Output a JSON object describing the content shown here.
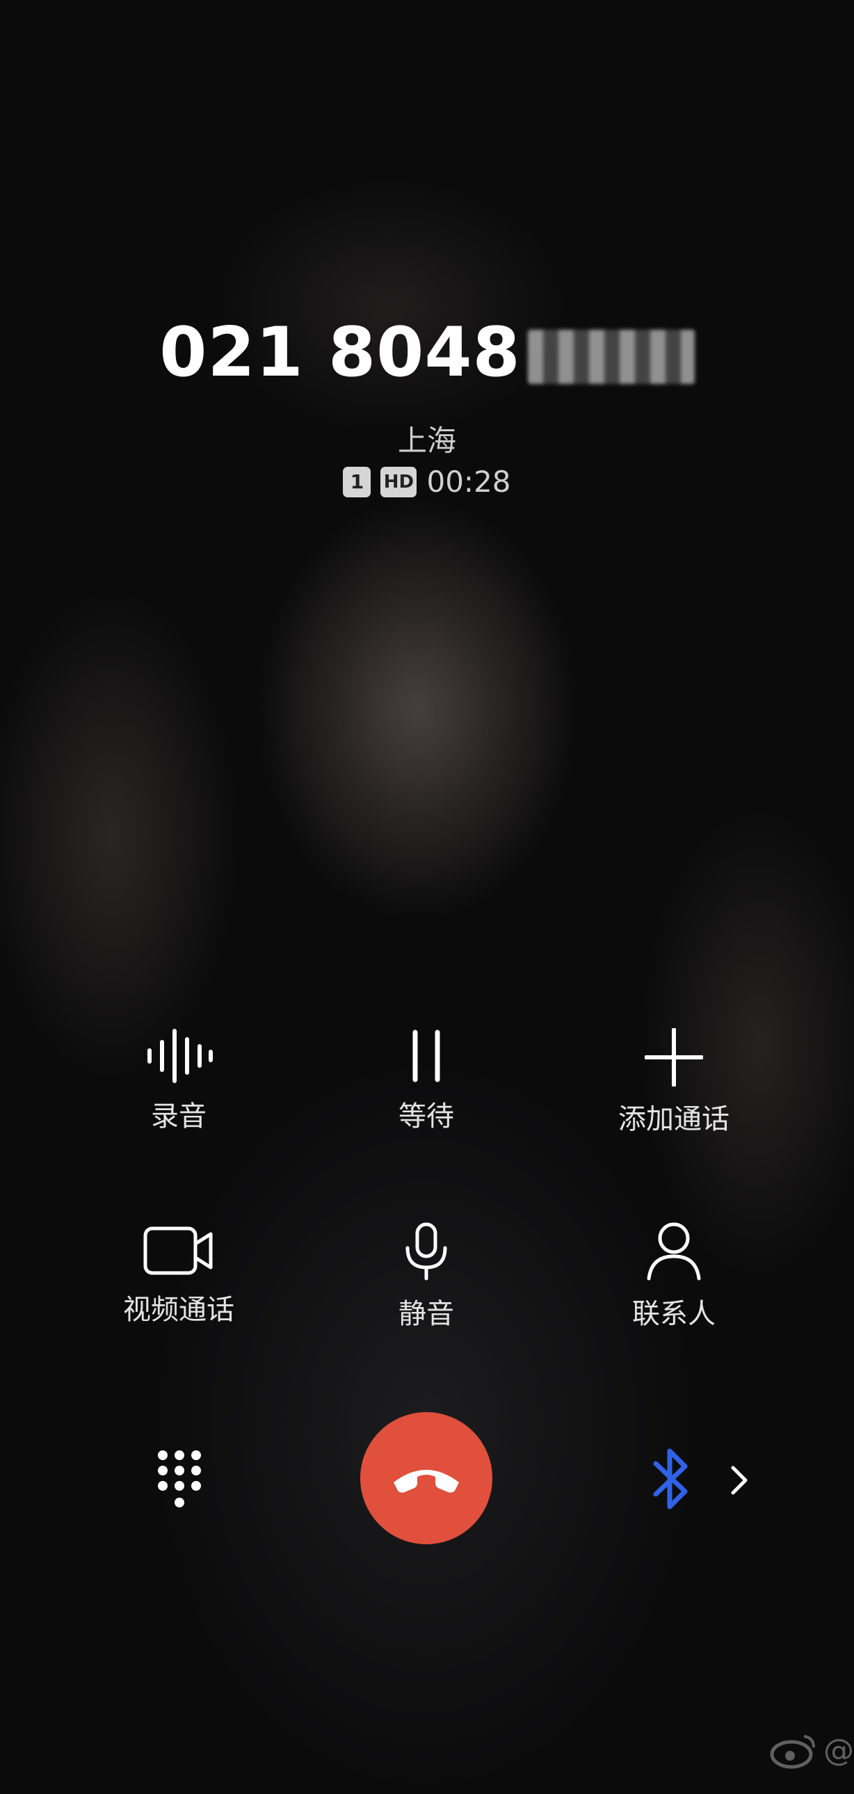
{
  "call": {
    "number_visible": "021 8048",
    "location": "上海",
    "sim_slot": "1",
    "quality_badge": "HD",
    "duration": "00:28"
  },
  "controls": {
    "record": "录音",
    "hold": "等待",
    "add_call": "添加通话",
    "video_call": "视频通话",
    "mute": "静音",
    "contacts": "联系人"
  },
  "bottom_bar": {
    "end_call_color": "#e0503c",
    "bluetooth_color": "#2f62e6",
    "icons": [
      "keypad-icon",
      "end-call-icon",
      "bluetooth-icon",
      "chevron-right-icon"
    ]
  },
  "watermark": "@"
}
